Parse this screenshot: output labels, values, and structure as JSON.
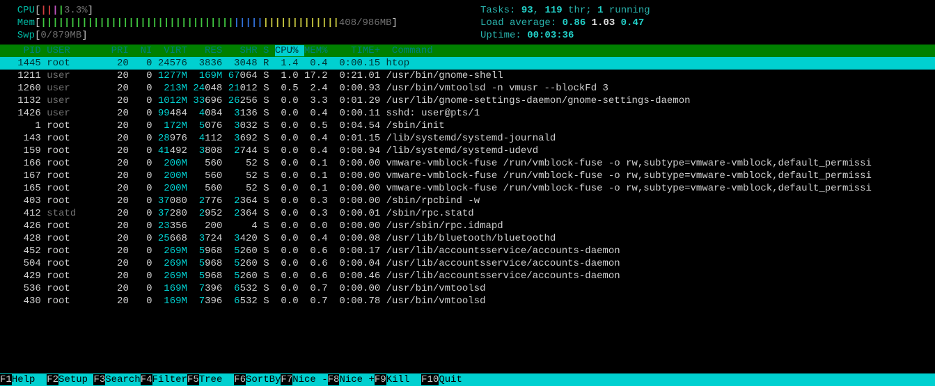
{
  "meters": {
    "cpu": {
      "label": "CPU",
      "usage": "3.3%",
      "bars": "||||"
    },
    "mem": {
      "label": "Mem",
      "usage": "408/986MB",
      "green_bars": 33,
      "blue_bars": 5,
      "yellow_bars": 13
    },
    "swp": {
      "label": "Swp",
      "usage": "0/879MB"
    }
  },
  "sysinfo": {
    "tasks_label": "Tasks: ",
    "tasks_procs": "93",
    "tasks_sep": ", ",
    "tasks_thr": "119",
    "tasks_thr_label": " thr; ",
    "running_n": "1",
    "running_label": " running",
    "load_label": "Load average: ",
    "load1": "0.86",
    "load2": "1.03",
    "load3": "0.47",
    "uptime_label": "Uptime: ",
    "uptime": "00:03:36"
  },
  "columns": {
    "pid": "PID",
    "user": "USER",
    "pri": "PRI",
    "ni": "NI",
    "virt": "VIRT",
    "res": "RES",
    "shr": "SHR",
    "s": "S",
    "cpu": "CPU%",
    "mem": "MEM%",
    "time": "TIME+",
    "cmd": "Command"
  },
  "processes": [
    {
      "pid": "1445",
      "user": "root",
      "pri": "20",
      "ni": "0",
      "virt": "24576",
      "res": "3836",
      "shr": "3048",
      "s": "R",
      "cpu": "1.4",
      "mem": "0.4",
      "time": "0:00.15",
      "cmd": "htop",
      "sel": true,
      "dimuser": false
    },
    {
      "pid": "1211",
      "user": "user",
      "pri": "20",
      "ni": "0",
      "virt": "1277M",
      "res": "169M",
      "shr": "67064",
      "s": "S",
      "cpu": "1.0",
      "mem": "17.2",
      "time": "0:21.01",
      "cmd": "/usr/bin/gnome-shell",
      "dimuser": true
    },
    {
      "pid": "1260",
      "user": "user",
      "pri": "20",
      "ni": "0",
      "virt": "213M",
      "res": "24048",
      "shr": "21012",
      "s": "S",
      "cpu": "0.5",
      "mem": "2.4",
      "time": "0:00.93",
      "cmd": "/usr/bin/vmtoolsd -n vmusr --blockFd 3",
      "dimuser": true
    },
    {
      "pid": "1132",
      "user": "user",
      "pri": "20",
      "ni": "0",
      "virt": "1012M",
      "res": "33696",
      "shr": "26256",
      "s": "S",
      "cpu": "0.0",
      "mem": "3.3",
      "time": "0:01.29",
      "cmd": "/usr/lib/gnome-settings-daemon/gnome-settings-daemon",
      "dimuser": true
    },
    {
      "pid": "1426",
      "user": "user",
      "pri": "20",
      "ni": "0",
      "virt": "99484",
      "res": "4084",
      "shr": "3136",
      "s": "S",
      "cpu": "0.0",
      "mem": "0.4",
      "time": "0:00.11",
      "cmd": "sshd: user@pts/1",
      "dimuser": true
    },
    {
      "pid": "1",
      "user": "root",
      "pri": "20",
      "ni": "0",
      "virt": "172M",
      "res": "5076",
      "shr": "3032",
      "s": "S",
      "cpu": "0.0",
      "mem": "0.5",
      "time": "0:04.54",
      "cmd": "/sbin/init",
      "dimuser": false
    },
    {
      "pid": "143",
      "user": "root",
      "pri": "20",
      "ni": "0",
      "virt": "28976",
      "res": "4112",
      "shr": "3692",
      "s": "S",
      "cpu": "0.0",
      "mem": "0.4",
      "time": "0:01.15",
      "cmd": "/lib/systemd/systemd-journald",
      "dimuser": false
    },
    {
      "pid": "159",
      "user": "root",
      "pri": "20",
      "ni": "0",
      "virt": "41492",
      "res": "3808",
      "shr": "2744",
      "s": "S",
      "cpu": "0.0",
      "mem": "0.4",
      "time": "0:00.94",
      "cmd": "/lib/systemd/systemd-udevd",
      "dimuser": false
    },
    {
      "pid": "166",
      "user": "root",
      "pri": "20",
      "ni": "0",
      "virt": "200M",
      "res": "560",
      "shr": "52",
      "s": "S",
      "cpu": "0.0",
      "mem": "0.1",
      "time": "0:00.00",
      "cmd": "vmware-vmblock-fuse /run/vmblock-fuse -o rw,subtype=vmware-vmblock,default_permissi",
      "dimuser": false
    },
    {
      "pid": "167",
      "user": "root",
      "pri": "20",
      "ni": "0",
      "virt": "200M",
      "res": "560",
      "shr": "52",
      "s": "S",
      "cpu": "0.0",
      "mem": "0.1",
      "time": "0:00.00",
      "cmd": "vmware-vmblock-fuse /run/vmblock-fuse -o rw,subtype=vmware-vmblock,default_permissi",
      "dimuser": false
    },
    {
      "pid": "165",
      "user": "root",
      "pri": "20",
      "ni": "0",
      "virt": "200M",
      "res": "560",
      "shr": "52",
      "s": "S",
      "cpu": "0.0",
      "mem": "0.1",
      "time": "0:00.00",
      "cmd": "vmware-vmblock-fuse /run/vmblock-fuse -o rw,subtype=vmware-vmblock,default_permissi",
      "dimuser": false
    },
    {
      "pid": "403",
      "user": "root",
      "pri": "20",
      "ni": "0",
      "virt": "37080",
      "res": "2776",
      "shr": "2364",
      "s": "S",
      "cpu": "0.0",
      "mem": "0.3",
      "time": "0:00.00",
      "cmd": "/sbin/rpcbind -w",
      "dimuser": false
    },
    {
      "pid": "412",
      "user": "statd",
      "pri": "20",
      "ni": "0",
      "virt": "37280",
      "res": "2952",
      "shr": "2364",
      "s": "S",
      "cpu": "0.0",
      "mem": "0.3",
      "time": "0:00.01",
      "cmd": "/sbin/rpc.statd",
      "dimuser": true
    },
    {
      "pid": "426",
      "user": "root",
      "pri": "20",
      "ni": "0",
      "virt": "23356",
      "res": "200",
      "shr": "4",
      "s": "S",
      "cpu": "0.0",
      "mem": "0.0",
      "time": "0:00.00",
      "cmd": "/usr/sbin/rpc.idmapd",
      "dimuser": false
    },
    {
      "pid": "428",
      "user": "root",
      "pri": "20",
      "ni": "0",
      "virt": "25668",
      "res": "3724",
      "shr": "3420",
      "s": "S",
      "cpu": "0.0",
      "mem": "0.4",
      "time": "0:00.08",
      "cmd": "/usr/lib/bluetooth/bluetoothd",
      "dimuser": false
    },
    {
      "pid": "452",
      "user": "root",
      "pri": "20",
      "ni": "0",
      "virt": "269M",
      "res": "5968",
      "shr": "5260",
      "s": "S",
      "cpu": "0.0",
      "mem": "0.6",
      "time": "0:00.17",
      "cmd": "/usr/lib/accountsservice/accounts-daemon",
      "dimuser": false
    },
    {
      "pid": "504",
      "user": "root",
      "pri": "20",
      "ni": "0",
      "virt": "269M",
      "res": "5968",
      "shr": "5260",
      "s": "S",
      "cpu": "0.0",
      "mem": "0.6",
      "time": "0:00.04",
      "cmd": "/usr/lib/accountsservice/accounts-daemon",
      "dimuser": false
    },
    {
      "pid": "429",
      "user": "root",
      "pri": "20",
      "ni": "0",
      "virt": "269M",
      "res": "5968",
      "shr": "5260",
      "s": "S",
      "cpu": "0.0",
      "mem": "0.6",
      "time": "0:00.46",
      "cmd": "/usr/lib/accountsservice/accounts-daemon",
      "dimuser": false
    },
    {
      "pid": "536",
      "user": "root",
      "pri": "20",
      "ni": "0",
      "virt": "169M",
      "res": "7396",
      "shr": "6532",
      "s": "S",
      "cpu": "0.0",
      "mem": "0.7",
      "time": "0:00.00",
      "cmd": "/usr/bin/vmtoolsd",
      "dimuser": false
    },
    {
      "pid": "430",
      "user": "root",
      "pri": "20",
      "ni": "0",
      "virt": "169M",
      "res": "7396",
      "shr": "6532",
      "s": "S",
      "cpu": "0.0",
      "mem": "0.7",
      "time": "0:00.78",
      "cmd": "/usr/bin/vmtoolsd",
      "dimuser": false
    }
  ],
  "footer": [
    {
      "key": "F1",
      "label": "Help  "
    },
    {
      "key": "F2",
      "label": "Setup "
    },
    {
      "key": "F3",
      "label": "Search"
    },
    {
      "key": "F4",
      "label": "Filter"
    },
    {
      "key": "F5",
      "label": "Tree  "
    },
    {
      "key": "F6",
      "label": "SortBy"
    },
    {
      "key": "F7",
      "label": "Nice -"
    },
    {
      "key": "F8",
      "label": "Nice +"
    },
    {
      "key": "F9",
      "label": "Kill  "
    },
    {
      "key": "F10",
      "label": "Quit  "
    }
  ]
}
